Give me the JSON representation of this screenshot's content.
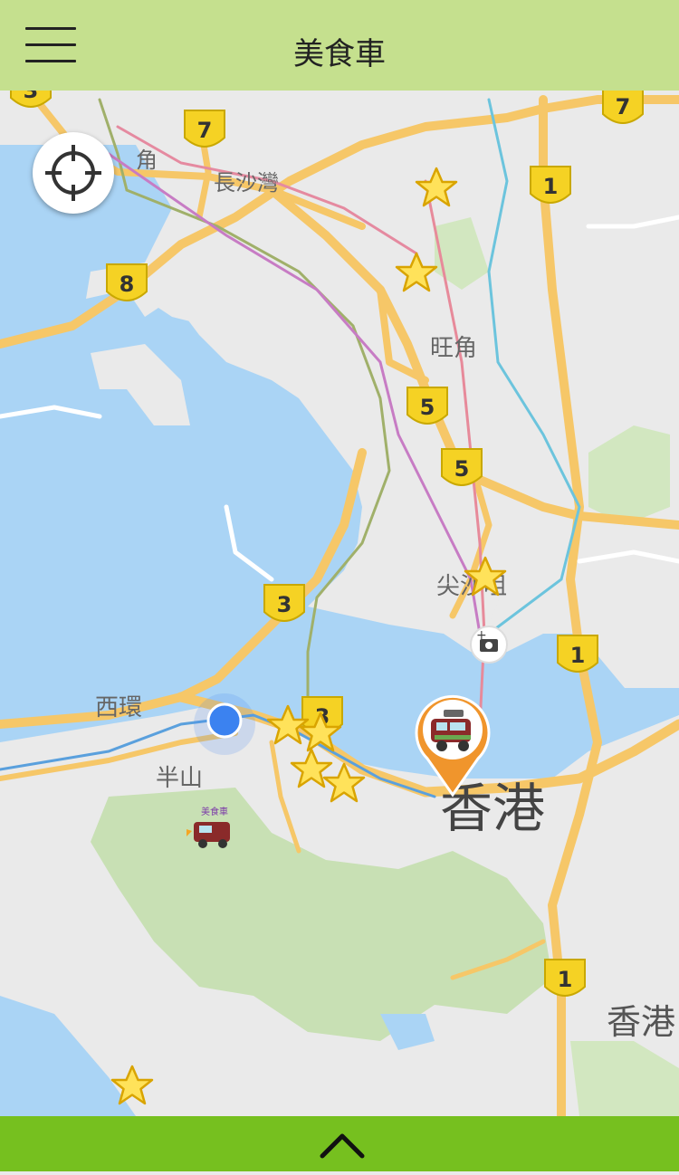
{
  "app": {
    "title": "美食車"
  },
  "header": {
    "menu_icon": "hamburger-menu-icon"
  },
  "map": {
    "place_labels": {
      "tsim_sha_tsui": "尖沙咀",
      "hong_kong": "香港",
      "mid_levels": "半山",
      "sai_wan": "西環",
      "cheung_sha_wan": "長沙灣",
      "mong_kok": "旺角",
      "tai_kok": "角",
      "hk_island": "香港"
    },
    "route_shields": [
      "7",
      "7",
      "1",
      "8",
      "5",
      "5",
      "3",
      "1",
      "1",
      "3",
      "3"
    ],
    "marker_label": "美食車",
    "marker_icon": "food-truck-pin-icon",
    "star_icon": "star-icon",
    "current_location_icon": "current-location-dot-icon",
    "camera_icon": "camera-poi-icon"
  },
  "controls": {
    "locate_icon": "crosshair-icon"
  },
  "bottom": {
    "icon": "chevron-up-icon"
  },
  "colors": {
    "header": "#c5e08e",
    "bottom_bar": "#76c01f",
    "water": "#aad4f5",
    "land": "#eaeaea",
    "park": "#c8e0b4",
    "road": "#f6c768",
    "shield": "#f5d224",
    "marker": "#f0952c"
  }
}
